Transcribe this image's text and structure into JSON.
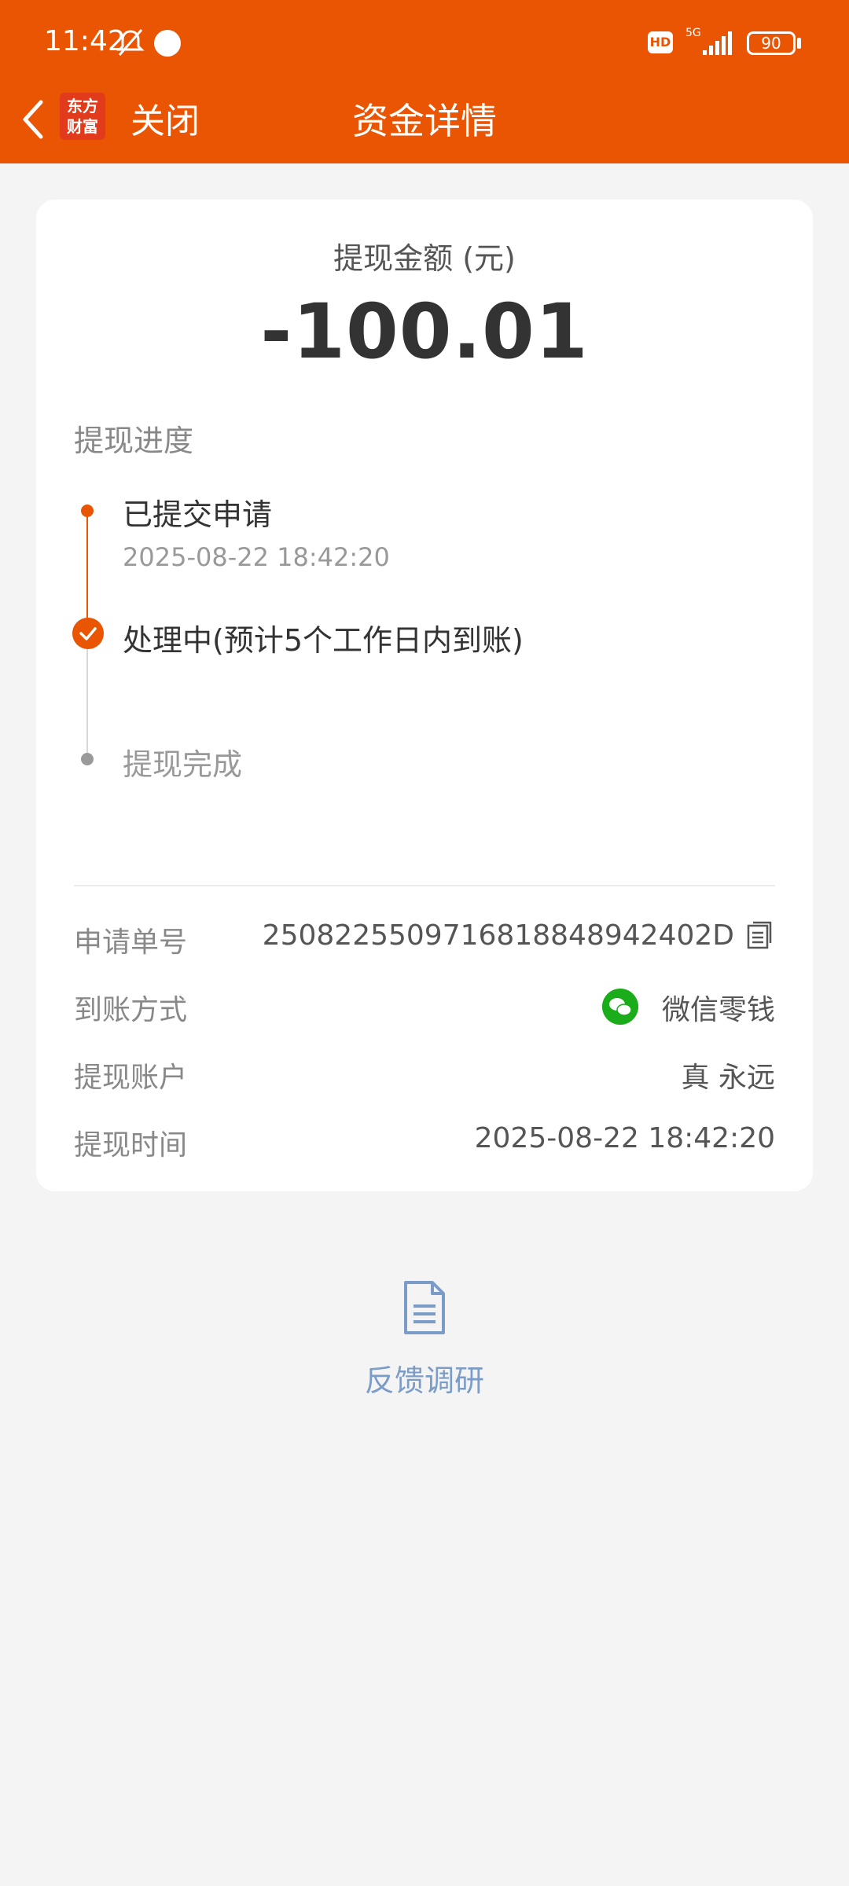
{
  "status_bar": {
    "time": "11:42",
    "hd": "HD",
    "network": "5G",
    "battery": "90"
  },
  "nav": {
    "logo_line1": "东方",
    "logo_line2": "财富",
    "close": "关闭",
    "title": "资金详情"
  },
  "amount": {
    "label": "提现金额 (元)",
    "value": "-100.01"
  },
  "progress": {
    "title": "提现进度",
    "steps": [
      {
        "label": "已提交申请",
        "time": "2025-08-22 18:42:20"
      },
      {
        "label": "处理中(预计5个工作日内到账)"
      },
      {
        "label": "提现完成"
      }
    ]
  },
  "details": [
    {
      "label": "申请单号",
      "value": "2508225509716818848942402D"
    },
    {
      "label": "到账方式",
      "value": "微信零钱"
    },
    {
      "label": "提现账户",
      "value": "真 永远"
    },
    {
      "label": "提现时间",
      "value": "2025-08-22 18:42:20"
    }
  ],
  "feedback": {
    "label": "反馈调研"
  },
  "colors": {
    "brand_orange": "#ea5504",
    "wechat_green": "#1aad19",
    "feedback_blue": "#7b9cc6"
  },
  "icons": [
    "bell-off-icon",
    "app-notification-icon",
    "signal-icon",
    "back-icon",
    "check-icon",
    "copy-icon",
    "wechat-icon",
    "document-icon"
  ]
}
